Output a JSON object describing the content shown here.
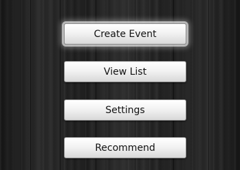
{
  "menu": {
    "selected_index": 0,
    "buttons": [
      {
        "label": "Create Event"
      },
      {
        "label": "View List"
      },
      {
        "label": "Settings"
      },
      {
        "label": "Recommend"
      }
    ]
  },
  "colors": {
    "background": "#1f1f1f",
    "button_face": "#f3f3f3",
    "button_text": "#111111",
    "selection_glow": "#ffffff"
  }
}
